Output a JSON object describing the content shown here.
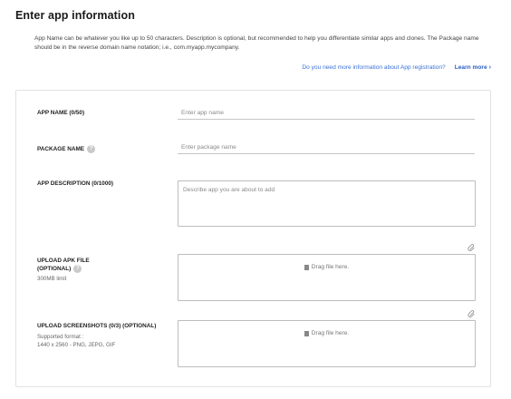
{
  "header": {
    "title": "Enter app information"
  },
  "intro": {
    "text": "App Name can be whatever you like up to 50 characters. Description is optional, but recommended to help you differentiate similar apps and clones. The Package name should be in the reverse domain name notation; i.e., com.myapp.mycompany."
  },
  "help": {
    "question": "Do you need more information about App registration?",
    "learn_more": "Learn more"
  },
  "form": {
    "app_name": {
      "label": "APP NAME (0/50)",
      "placeholder": "Enter app name"
    },
    "package_name": {
      "label": "PACKAGE NAME",
      "help_glyph": "?",
      "placeholder": "Enter package name"
    },
    "description": {
      "label": "APP DESCRIPTION (0/1000)",
      "placeholder": "Describe app you are about to add"
    },
    "apk": {
      "label_line1": "UPLOAD APK FILE",
      "label_line2": "(OPTIONAL)",
      "help_glyph": "?",
      "sub": "300MB limit",
      "drop_text": "Drag file here."
    },
    "screenshots": {
      "label": "UPLOAD SCREENSHOTS (0/3) (OPTIONAL)",
      "sub_line1": "Supported format :",
      "sub_line2": "1440 x 2560 - PNG, JEPG, GIF",
      "drop_text": "Drag file here."
    }
  },
  "colors": {
    "link": "#3a72d6",
    "border": "#bdbdbd",
    "text": "#1e1e1e"
  },
  "icons": {
    "learn_more_chevron": "chevron-right-icon",
    "help": "question-icon",
    "drop": "file-icon",
    "attach": "paperclip-icon"
  }
}
